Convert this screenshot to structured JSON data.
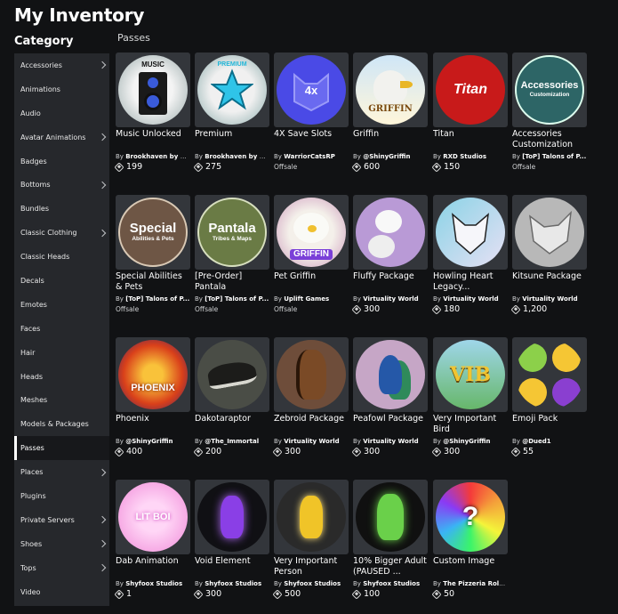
{
  "page": {
    "title": "My Inventory",
    "category_heading": "Category",
    "section_label": "Passes"
  },
  "sidebar": {
    "items": [
      {
        "label": "Accessories",
        "chevron": true
      },
      {
        "label": "Animations",
        "chevron": false
      },
      {
        "label": "Audio",
        "chevron": false
      },
      {
        "label": "Avatar Animations",
        "chevron": true
      },
      {
        "label": "Badges",
        "chevron": false
      },
      {
        "label": "Bottoms",
        "chevron": true
      },
      {
        "label": "Bundles",
        "chevron": false
      },
      {
        "label": "Classic Clothing",
        "chevron": true
      },
      {
        "label": "Classic Heads",
        "chevron": false
      },
      {
        "label": "Decals",
        "chevron": false
      },
      {
        "label": "Emotes",
        "chevron": false
      },
      {
        "label": "Faces",
        "chevron": false
      },
      {
        "label": "Hair",
        "chevron": false
      },
      {
        "label": "Heads",
        "chevron": false
      },
      {
        "label": "Meshes",
        "chevron": false
      },
      {
        "label": "Models & Packages",
        "chevron": false
      },
      {
        "label": "Passes",
        "chevron": false,
        "active": true
      },
      {
        "label": "Places",
        "chevron": true
      },
      {
        "label": "Plugins",
        "chevron": false
      },
      {
        "label": "Private Servers",
        "chevron": true
      },
      {
        "label": "Shoes",
        "chevron": true
      },
      {
        "label": "Tops",
        "chevron": true
      },
      {
        "label": "Video",
        "chevron": false
      }
    ]
  },
  "items": [
    {
      "name": "Music Unlocked",
      "by": "By",
      "creator": "Brookhaven by V...",
      "price": "199",
      "art": "music"
    },
    {
      "name": "Premium",
      "by": "By",
      "creator": "Brookhaven by V...",
      "price": "275",
      "art": "premium"
    },
    {
      "name": "4X Save Slots",
      "by": "By",
      "creator": "WarriorCatsRP",
      "offsale": "Offsale",
      "art": "save"
    },
    {
      "name": "Griffin",
      "by": "By",
      "creator": "@ShinyGriffin",
      "price": "600",
      "art": "griffin"
    },
    {
      "name": "Titan",
      "by": "By",
      "creator": "RXD Studios",
      "price": "150",
      "art": "titan"
    },
    {
      "name": "Accessories Customization",
      "by": "By",
      "creator": "[ToP] Talons of P...",
      "offsale": "Offsale",
      "art": "accessories"
    },
    {
      "name": "Special Abilities & Pets",
      "by": "By",
      "creator": "[ToP] Talons of P...",
      "offsale": "Offsale",
      "art": "special"
    },
    {
      "name": "[Pre-Order] Pantala",
      "by": "By",
      "creator": "[ToP] Talons of P...",
      "offsale": "Offsale",
      "art": "pantala"
    },
    {
      "name": "Pet Griffin",
      "by": "By",
      "creator": "Uplift Games",
      "offsale": "Offsale",
      "art": "petgriffin"
    },
    {
      "name": "Fluffy Package",
      "by": "By",
      "creator": "Virtuality World",
      "price": "300",
      "art": "fluffy"
    },
    {
      "name": "Howling Heart Legacy...",
      "by": "By",
      "creator": "Virtuality World",
      "price": "180",
      "art": "howling"
    },
    {
      "name": "Kitsune Package",
      "by": "By",
      "creator": "Virtuality World",
      "price": "1,200",
      "art": "kitsune"
    },
    {
      "name": "Phoenix",
      "by": "By",
      "creator": "@ShinyGriffin",
      "price": "400",
      "art": "phoenix"
    },
    {
      "name": "Dakotaraptor",
      "by": "By",
      "creator": "@The_Immortal",
      "price": "200",
      "art": "raptor"
    },
    {
      "name": "Zebroid Package",
      "by": "By",
      "creator": "Virtuality World",
      "price": "300",
      "art": "zebroid"
    },
    {
      "name": "Peafowl Package",
      "by": "By",
      "creator": "Virtuality World",
      "price": "300",
      "art": "peafowl"
    },
    {
      "name": "Very Important Bird",
      "by": "By",
      "creator": "@ShinyGriffin",
      "price": "300",
      "art": "vib"
    },
    {
      "name": "Emoji Pack",
      "by": "By",
      "creator": "@Dued1",
      "price": "55",
      "art": "emoji"
    },
    {
      "name": "Dab Animation",
      "by": "By",
      "creator": "Shyfoox Studios",
      "price": "1",
      "art": "dab"
    },
    {
      "name": "Void Element",
      "by": "By",
      "creator": "Shyfoox Studios",
      "price": "300",
      "art": "void"
    },
    {
      "name": "Very Important Person",
      "by": "By",
      "creator": "Shyfoox Studios",
      "price": "500",
      "art": "vip"
    },
    {
      "name": "10% Bigger Adult (PAUSED ...",
      "by": "By",
      "creator": "Shyfoox Studios",
      "price": "100",
      "art": "bigger"
    },
    {
      "name": "Custom Image",
      "by": "By",
      "creator": "The Pizzeria Role...",
      "price": "50",
      "art": "custom"
    }
  ],
  "art_text": {
    "music": "MUSIC",
    "premium": "PREMIUM",
    "save": "4x",
    "griffin": "GRIFFIN",
    "titan": "Titan",
    "accessories_1": "Accessories",
    "accessories_2": "Customization",
    "special_1": "Special",
    "special_2": "Abilities & Pets",
    "pantala_1": "Pantala",
    "pantala_2": "Tribes & Maps",
    "petgriffin": "GRIFFIN",
    "phoenix": "PHOENIX",
    "vib": "VIB",
    "dab": "LIT BOI",
    "custom": "?"
  }
}
